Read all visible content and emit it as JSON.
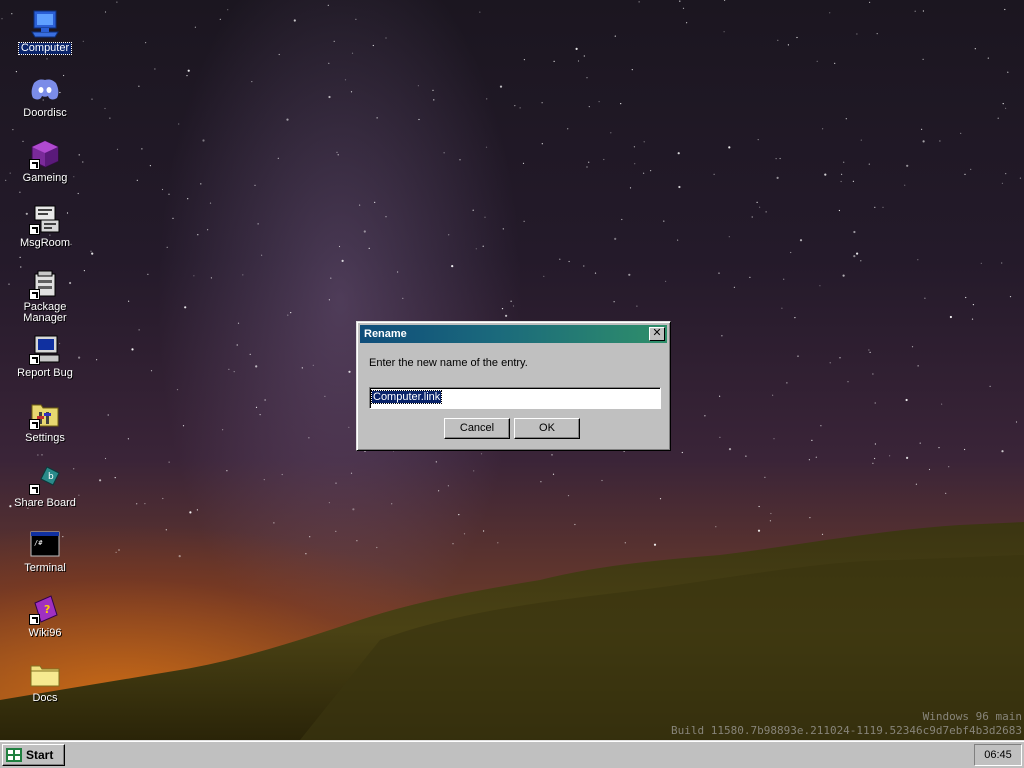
{
  "desktop": {
    "icons": [
      {
        "label": "Computer",
        "icon": "computer-icon",
        "shortcut": false,
        "selected": true
      },
      {
        "label": "Doordisc",
        "icon": "discord-icon",
        "shortcut": false,
        "selected": false
      },
      {
        "label": "Gameing",
        "icon": "game-cube-icon",
        "shortcut": true,
        "selected": false
      },
      {
        "label": "MsgRoom",
        "icon": "chat-room-icon",
        "shortcut": true,
        "selected": false
      },
      {
        "label": "Package Manager",
        "icon": "package-manager-icon",
        "shortcut": true,
        "selected": false
      },
      {
        "label": "Report Bug",
        "icon": "report-bug-icon",
        "shortcut": true,
        "selected": false
      },
      {
        "label": "Settings",
        "icon": "settings-icon",
        "shortcut": true,
        "selected": false
      },
      {
        "label": "Share Board",
        "icon": "share-board-icon",
        "shortcut": true,
        "selected": false
      },
      {
        "label": "Terminal",
        "icon": "terminal-icon",
        "shortcut": false,
        "selected": false
      },
      {
        "label": "Wiki96",
        "icon": "wiki-book-icon",
        "shortcut": true,
        "selected": false
      },
      {
        "label": "Docs",
        "icon": "folder-icon",
        "shortcut": false,
        "selected": false
      }
    ],
    "build_info": {
      "line1": "Windows 96 main",
      "line2": "Build 11580.7b98893e.211024-1119.52346c9d7ebf4b3d2683"
    }
  },
  "dialog": {
    "title": "Rename",
    "message": "Enter the new name of the entry.",
    "input_value": "Computer.link",
    "cancel_label": "Cancel",
    "ok_label": "OK",
    "close_glyph": "✕"
  },
  "taskbar": {
    "start_label": "Start",
    "clock": "06:45"
  },
  "colors": {
    "selection": "#0a246a",
    "face": "#c0c0c0",
    "titlebar_start": "#0f4d7a",
    "titlebar_end": "#2f8f6a"
  }
}
